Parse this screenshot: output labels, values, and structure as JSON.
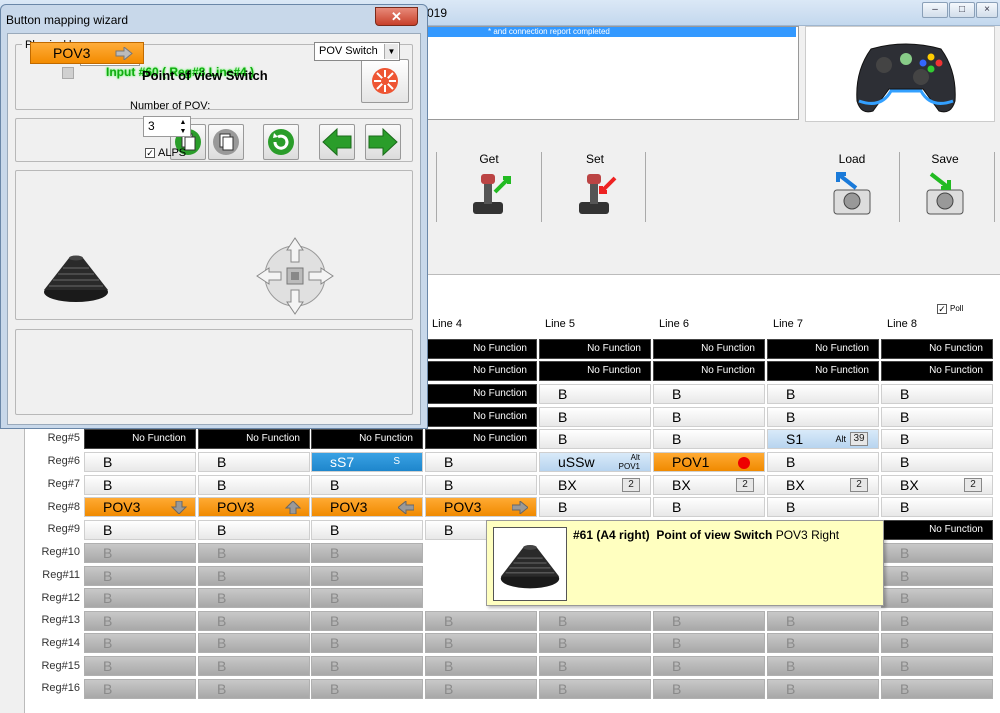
{
  "main": {
    "title_fragment": "019",
    "log_text": "* and connection report completed"
  },
  "toolbar": {
    "get_label": "Get",
    "set_label": "Set",
    "load_label": "Load",
    "save_label": "Save"
  },
  "grid": {
    "poll_label": "Poll",
    "columns": [
      "Line 4",
      "Line 5",
      "Line 6",
      "Line 7",
      "Line 8"
    ],
    "rows": [
      "Reg#5",
      "Reg#6",
      "Reg#7",
      "Reg#8",
      "Reg#9",
      "Reg#10",
      "Reg#11",
      "Reg#12",
      "Reg#13",
      "Reg#14",
      "Reg#15",
      "Reg#16"
    ],
    "no_function": "No Function",
    "b": "B",
    "sS7": "sS7",
    "sS7_tag": "S",
    "uSSw": "uSSw",
    "uSSw_alt": "Alt",
    "uSSw_pov": "POV1",
    "pov1": "POV1",
    "s1": "S1",
    "s1_alt": "Alt",
    "s1_badge": "39",
    "bx": "BX",
    "bx_badge": "2",
    "pov3": "POV3"
  },
  "tooltip": {
    "id": "#61 (A4 right)",
    "name": "Point of view Switch",
    "detail": "POV3  Right"
  },
  "wizard": {
    "title": "Button mapping wizard",
    "close": "✕",
    "physical_layer": "Physical layer",
    "input_text": "Input #60  ( Reg#8  Line#4 )",
    "spin_value": "60",
    "pov_button": "POV3",
    "pov_type": "POV Switch",
    "pov_name": "Point of view Switch",
    "num_pov_label": "Number of POV:",
    "num_pov_value": "3",
    "alps_label": "ALPS",
    "alps_checked": "✓"
  },
  "colors": {
    "orange": "#f38b00",
    "blue": "#1e86cc",
    "tooltip": "#ffffc0",
    "green_icon": "#2a9d2a"
  }
}
